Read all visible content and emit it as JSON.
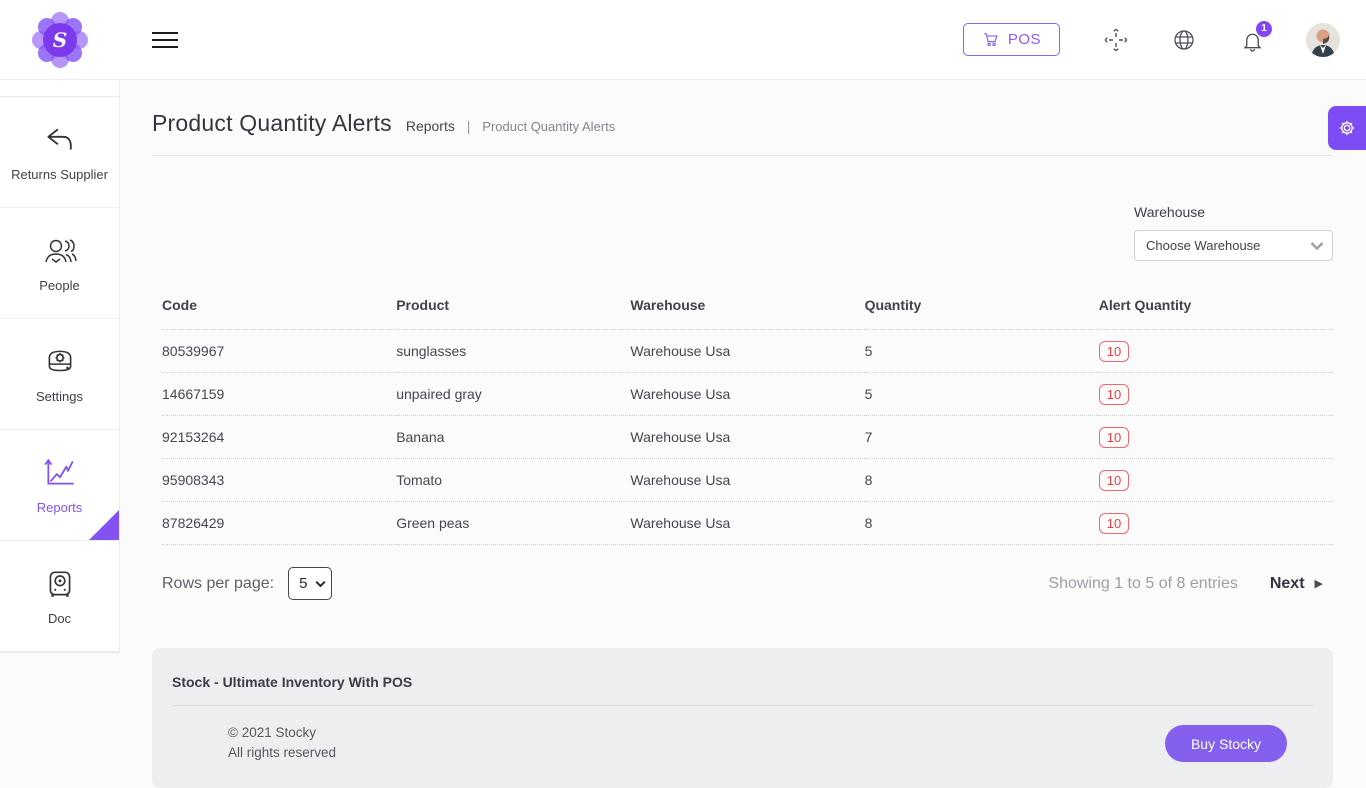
{
  "header": {
    "pos_button_label": "POS",
    "notification_count": "1"
  },
  "sidebar": {
    "items": [
      {
        "label": "Returns Supplier",
        "icon": "return-arrow-icon",
        "active": false
      },
      {
        "label": "People",
        "icon": "people-icon",
        "active": false
      },
      {
        "label": "Settings",
        "icon": "settings-drive-icon",
        "active": false
      },
      {
        "label": "Reports",
        "icon": "report-chart-icon",
        "active": true
      },
      {
        "label": "Doc",
        "icon": "doc-box-icon",
        "active": false
      }
    ]
  },
  "page": {
    "title": "Product Quantity Alerts",
    "breadcrumb_section": "Reports",
    "breadcrumb_separator": "|",
    "breadcrumb_current": "Product Quantity Alerts"
  },
  "filter": {
    "label": "Warehouse",
    "selected_option": "Choose Warehouse"
  },
  "table": {
    "columns": [
      "Code",
      "Product",
      "Warehouse",
      "Quantity",
      "Alert Quantity"
    ],
    "rows": [
      {
        "code": "80539967",
        "product": "sunglasses",
        "warehouse": "Warehouse Usa",
        "quantity": "5",
        "alert_quantity": "10"
      },
      {
        "code": "14667159",
        "product": "unpaired gray",
        "warehouse": "Warehouse Usa",
        "quantity": "5",
        "alert_quantity": "10"
      },
      {
        "code": "92153264",
        "product": "Banana",
        "warehouse": "Warehouse Usa",
        "quantity": "7",
        "alert_quantity": "10"
      },
      {
        "code": "95908343",
        "product": "Tomato",
        "warehouse": "Warehouse Usa",
        "quantity": "8",
        "alert_quantity": "10"
      },
      {
        "code": "87826429",
        "product": "Green peas",
        "warehouse": "Warehouse Usa",
        "quantity": "8",
        "alert_quantity": "10"
      }
    ]
  },
  "pagination": {
    "rows_per_page_label": "Rows per page:",
    "rows_per_page_value": "5",
    "showing_text": "Showing 1 to 5 of 8 entries",
    "next_label": "Next",
    "next_arrow": "▶"
  },
  "footer": {
    "title": "Stock - Ultimate Inventory With POS",
    "copyright": "© 2021 Stocky",
    "rights": "All rights reserved",
    "buy_button_label": "Buy Stocky"
  },
  "colors": {
    "primary_purple": "#8352f1",
    "logo_purple": "#7c3aed",
    "alert_red": "#ee3d46",
    "footer_bg": "#eceef0"
  }
}
